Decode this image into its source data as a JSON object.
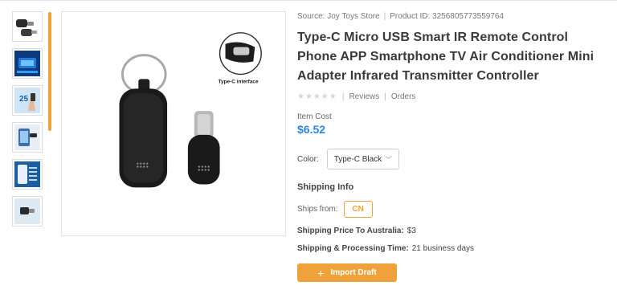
{
  "product": {
    "source_label": "Source: Joy Toys Store",
    "product_id_label": "Product ID: 3256805773559764",
    "title": "Type-C Micro USB Smart IR Remote Control Phone APP Smartphone TV Air Conditioner Mini Adapter Infrared Transmitter Controller",
    "reviews_label": "Reviews",
    "orders_label": "Orders",
    "cost_label": "Item Cost",
    "price": "$6.52",
    "color_label": "Color:",
    "color_selected": "Type-C Black",
    "shipping_title": "Shipping Info",
    "ships_from_label": "Ships from:",
    "ships_from_value": "CN",
    "shipping_price_label": "Shipping Price To Australia:",
    "shipping_price_value": "$3",
    "processing_label": "Shipping & Processing Time:",
    "processing_value": "21 business days",
    "import_button": "Import Draft"
  },
  "main_image": {
    "callout_text": "Type-C interface"
  },
  "thumbnails": [
    {
      "icon": "adapter-thumb"
    },
    {
      "icon": "chip-thumb"
    },
    {
      "icon": "hand-thumb"
    },
    {
      "icon": "phone-thumb"
    },
    {
      "icon": "screen-thumb"
    },
    {
      "icon": "device-thumb"
    }
  ],
  "colors": {
    "accent": "#f0a23a",
    "price": "#2e86de"
  }
}
